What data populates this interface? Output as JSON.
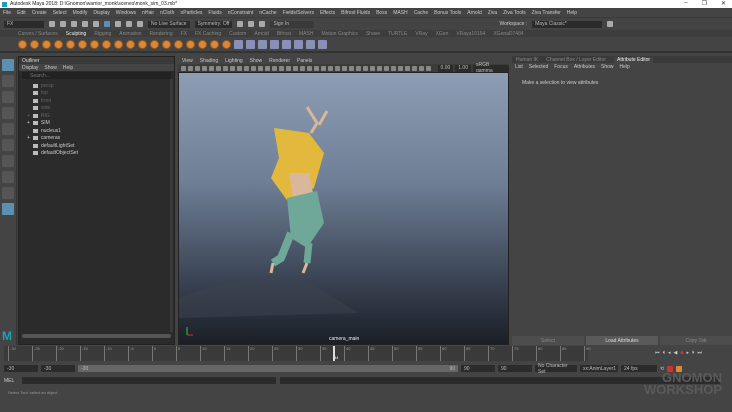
{
  "window": {
    "title": "Autodesk Maya 2018: D:\\Gnomon\\warrior_monk\\scenes\\monk_sim_03.mb*",
    "controls": [
      "–",
      "❐",
      "✕"
    ]
  },
  "menu": [
    "File",
    "Edit",
    "Create",
    "Select",
    "Modify",
    "Display",
    "Windows",
    "nHair",
    "nCloth",
    "nParticles",
    "Fluids",
    "nConstraint",
    "nCache",
    "Fields/Solvers",
    "Effects",
    "Bifrost Fluids",
    "Boss",
    "MASH",
    "Cache",
    "Bonus Tools",
    "Arnold",
    "Ziva",
    "Ziva Tools",
    "Ziva Transfer",
    "Help"
  ],
  "status": {
    "menuset": "FX",
    "live_surface": "No Live Surface",
    "symmetry": "Symmetry: Off",
    "sign_in": "Sign In",
    "workspace_label": "Workspace :",
    "workspace": "Maya Classic*"
  },
  "shelf_tabs": [
    "Curves / Surfaces",
    "Sculpting",
    "Rigging",
    "Animation",
    "Rendering",
    "FX",
    "FX Caching",
    "Custom",
    "Arnold",
    "Bifrost",
    "MASH",
    "Motion Graphics",
    "Shave",
    "TURTLE",
    "VRay",
    "XGen",
    "VRaya10164",
    "XGenaD7484"
  ],
  "active_shelf": "Sculpting",
  "outliner": {
    "title": "Outliner",
    "menu": [
      "Display",
      "Show",
      "Help"
    ],
    "search_placeholder": "Search...",
    "items": [
      {
        "label": "persp",
        "dim": true
      },
      {
        "label": "top",
        "dim": true
      },
      {
        "label": "front",
        "dim": true
      },
      {
        "label": "side",
        "dim": true
      },
      {
        "label": "RIG",
        "dim": true,
        "expand": true
      },
      {
        "label": "SIM",
        "expand": true
      },
      {
        "label": "nucleus1"
      },
      {
        "label": "cameras",
        "expand": true
      },
      {
        "label": "defaultLightSet"
      },
      {
        "label": "defaultObjectSet"
      }
    ]
  },
  "viewport": {
    "menu": [
      "View",
      "Shading",
      "Lighting",
      "Show",
      "Renderer",
      "Panels"
    ],
    "exposure": "0.00",
    "gamma": "1.00",
    "colorspace": "sRGB gamma",
    "camera": "camera_main"
  },
  "attr": {
    "tabs": [
      "Human IK",
      "Channel Box / Layer Editor",
      "Attribute Editor"
    ],
    "menu": [
      "List",
      "Selected",
      "Focus",
      "Attributes",
      "Show",
      "Help"
    ],
    "message": "Make a selection to view attributes",
    "buttons": [
      "Select",
      "Load Attributes",
      "Copy Tab"
    ]
  },
  "timeline": {
    "ticks": [
      "-30",
      "-25",
      "-20",
      "-15",
      "-10",
      "-5",
      "0",
      "5",
      "10",
      "15",
      "20",
      "25",
      "30",
      "35",
      "40",
      "45",
      "50",
      "55",
      "60",
      "65",
      "70",
      "75",
      "80",
      "85",
      "90"
    ],
    "current": "34"
  },
  "range": {
    "start": "-30",
    "anim_start": "-30",
    "slider_start": "-30",
    "slider_end": "90",
    "anim_end": "90",
    "end": "90",
    "character_set": "No Character Set",
    "anim_layer": "xx:AnimLayer1",
    "fps": "24 fps"
  },
  "cmd": {
    "label": "MEL"
  },
  "help_line": "Select Tool: select an object",
  "watermark": "THE GNOMON WORKSHOP"
}
